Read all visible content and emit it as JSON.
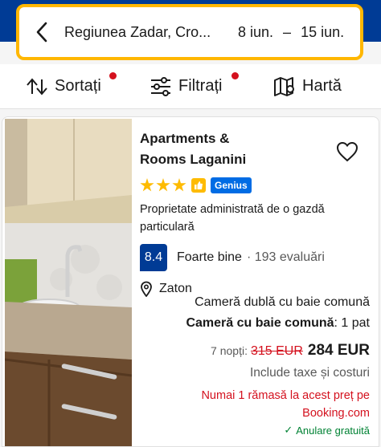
{
  "search": {
    "destination": "Regiunea Zadar, Cro...",
    "date_start": "8 iun.",
    "date_separator": "–",
    "date_end": "15 iun."
  },
  "toolbar": {
    "sort_label": "Sortați",
    "filter_label": "Filtrați",
    "map_label": "Hartă"
  },
  "listing": {
    "name_line1": "Apartments &",
    "name_line2": "Rooms Laganini",
    "stars": 3,
    "badge_label": "Genius",
    "managed_by": "Proprietate administrată de o gazdă particulară",
    "score": "8.4",
    "score_word": "Foarte bine",
    "review_count": "· 193 evaluări",
    "location": "Zaton",
    "room_type": "Cameră dublă cu baie comună",
    "room_summary_bold": "Cameră cu baie comună",
    "room_summary_rest": ": 1 pat",
    "nights": "7 nopți:",
    "old_price": "315 EUR",
    "new_price": "284 EUR",
    "taxes": "Include taxe și costuri",
    "urgency": "Numai 1 rămasă la acest preț pe Booking.com",
    "cancellation": "Anulare gratuită"
  },
  "colors": {
    "brand_blue": "#003b95",
    "highlight_yellow": "#ffb700",
    "star_yellow": "#febb02",
    "alert_red": "#d4111e",
    "success_green": "#008234",
    "genius_blue": "#006ce4"
  }
}
